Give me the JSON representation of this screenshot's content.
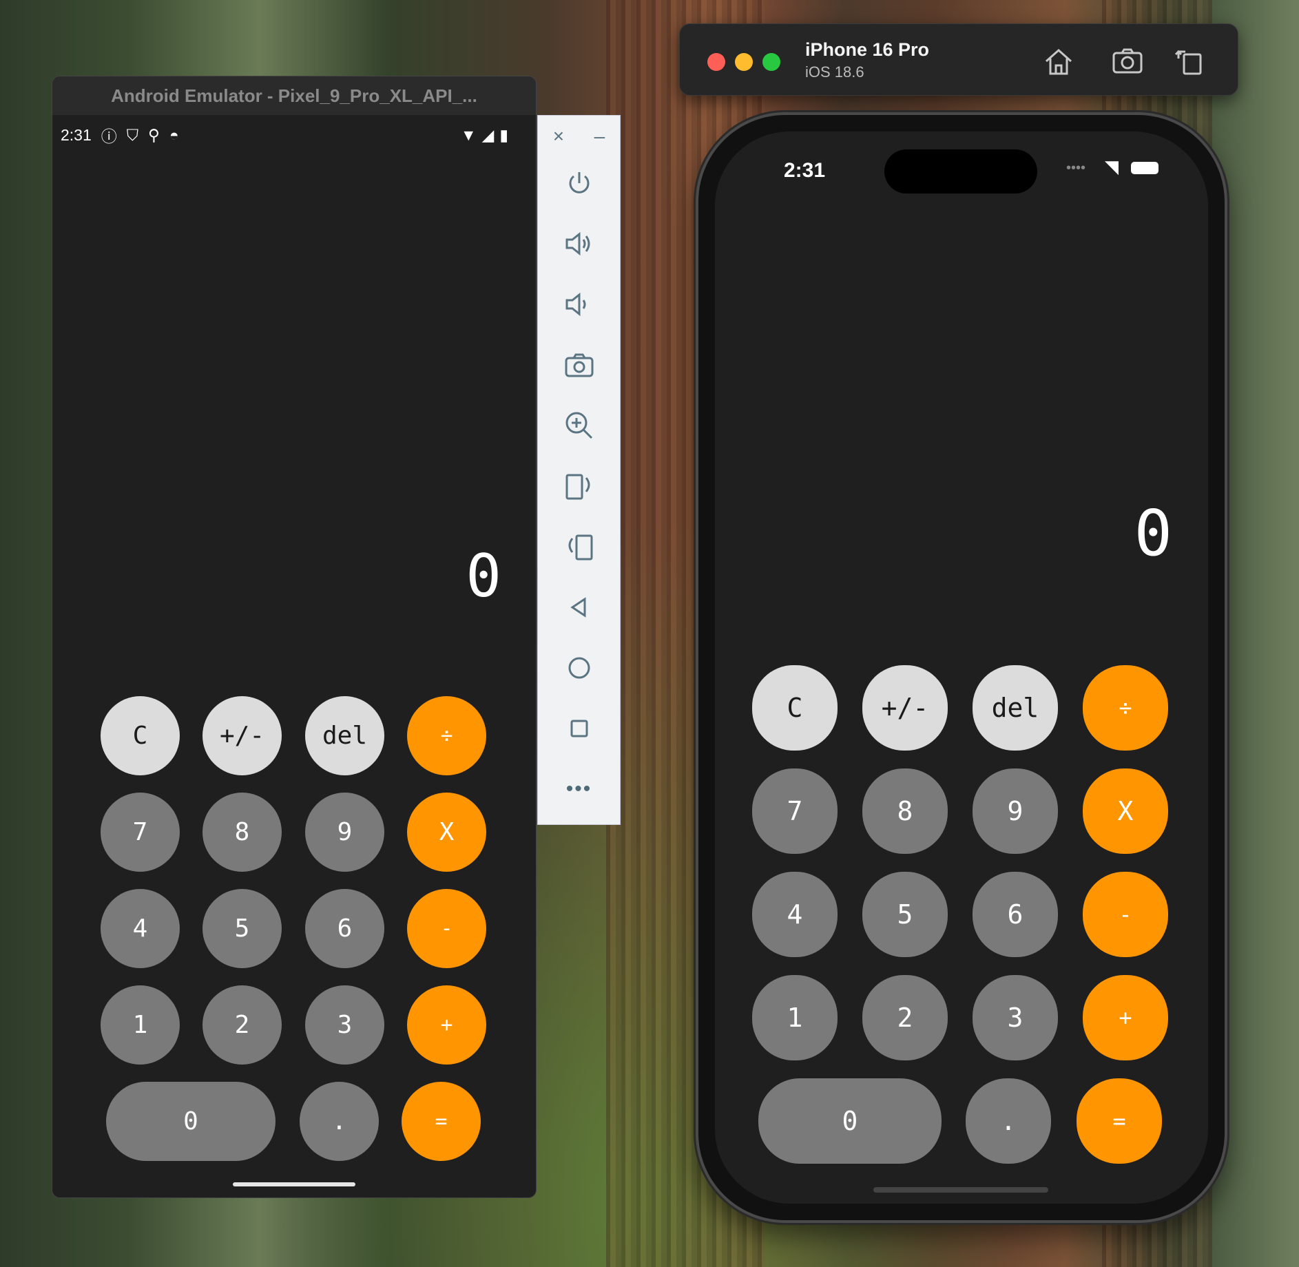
{
  "android": {
    "window_title": "Android Emulator - Pixel_9_Pro_XL_API_...",
    "time": "2:31",
    "display": "0",
    "toolbar": [
      "close-icon",
      "minimize-icon",
      "power-icon",
      "volume-up-icon",
      "volume-down-icon",
      "camera-icon",
      "zoom-icon",
      "rotate-left-icon",
      "rotate-right-icon",
      "back-icon",
      "home-icon",
      "overview-icon",
      "more-icon"
    ]
  },
  "ios": {
    "device": "iPhone 16 Pro",
    "os": "iOS 18.6",
    "time": "2:31",
    "display": "0"
  },
  "keys": {
    "r1": [
      "C",
      "+/-",
      "del",
      "÷"
    ],
    "r2": [
      "7",
      "8",
      "9",
      "X"
    ],
    "r3": [
      "4",
      "5",
      "6",
      "-"
    ],
    "r4": [
      "1",
      "2",
      "3",
      "+"
    ],
    "r5": [
      "0",
      ".",
      "="
    ]
  },
  "colors": {
    "orange": "#ff9500",
    "gray": "#7a7a7a",
    "light": "#dcdcdc"
  }
}
